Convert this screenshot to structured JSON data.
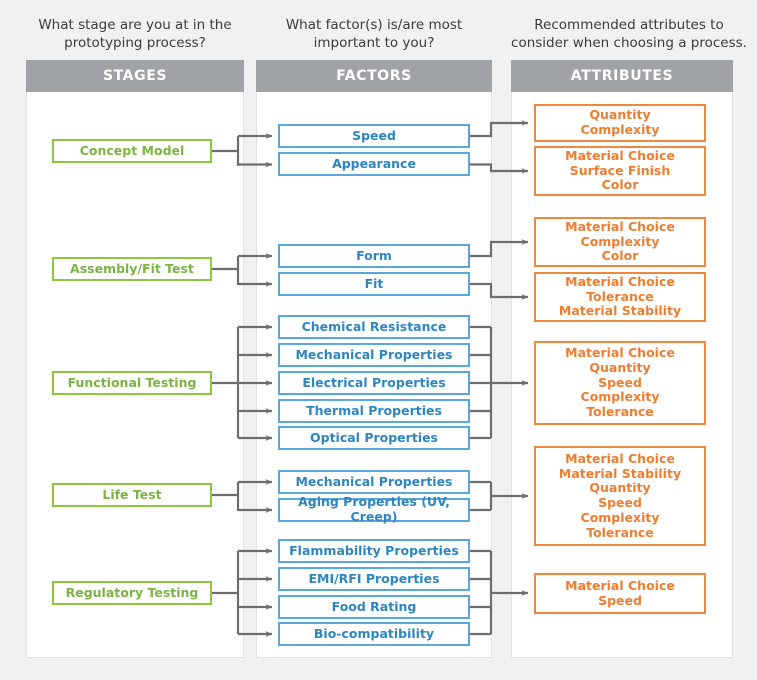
{
  "questions": {
    "stages": "What stage are you at in the prototyping process?",
    "factors": "What factor(s) is/are most important to you?",
    "attributes": "Recommended attributes to consider when choosing a process."
  },
  "headers": {
    "stages": "STAGES",
    "factors": "FACTORS",
    "attributes": "ATTRIBUTES"
  },
  "colors": {
    "background": "#f1f1f1",
    "panel": "#ffffff",
    "header": "#9fa3a6",
    "stage_border": "#8dc63f",
    "stage_text": "#7cb342",
    "factor_border": "#58a7dd",
    "factor_text": "#2e86c1",
    "attribute_border": "#f0883c",
    "attribute_text": "#ed7d31",
    "connector": "#6e6e6e"
  },
  "stages": [
    {
      "label": "Concept Model"
    },
    {
      "label": "Assembly/Fit Test"
    },
    {
      "label": "Functional Testing"
    },
    {
      "label": "Life Test"
    },
    {
      "label": "Regulatory Testing"
    }
  ],
  "factors": [
    {
      "label": "Speed"
    },
    {
      "label": "Appearance"
    },
    {
      "label": "Form"
    },
    {
      "label": "Fit"
    },
    {
      "label": "Chemical Resistance"
    },
    {
      "label": "Mechanical Properties"
    },
    {
      "label": "Electrical Properties"
    },
    {
      "label": "Thermal Properties"
    },
    {
      "label": "Optical Properties"
    },
    {
      "label": "Mechanical Properties"
    },
    {
      "label": "Aging Properties (UV, Creep)"
    },
    {
      "label": "Flammability Properties"
    },
    {
      "label": "EMI/RFI Properties"
    },
    {
      "label": "Food Rating"
    },
    {
      "label": "Bio-compatibility"
    }
  ],
  "attributes": [
    {
      "label": "Quantity\nComplexity"
    },
    {
      "label": "Material Choice\nSurface Finish\nColor"
    },
    {
      "label": "Material Choice\nComplexity\nColor"
    },
    {
      "label": "Material Choice\nTolerance\nMaterial Stability"
    },
    {
      "label": "Material Choice\nQuantity\nSpeed\nComplexity\nTolerance"
    },
    {
      "label": "Material Choice\nMaterial Stability\nQuantity\nSpeed\nComplexity\nTolerance"
    },
    {
      "label": "Material Choice\nSpeed"
    }
  ],
  "mapping": {
    "stage_to_factors": [
      {
        "stage": "Concept Model",
        "factors": [
          "Speed",
          "Appearance"
        ]
      },
      {
        "stage": "Assembly/Fit Test",
        "factors": [
          "Form",
          "Fit"
        ]
      },
      {
        "stage": "Functional Testing",
        "factors": [
          "Chemical Resistance",
          "Mechanical Properties",
          "Electrical Properties",
          "Thermal Properties",
          "Optical Properties"
        ]
      },
      {
        "stage": "Life Test",
        "factors": [
          "Mechanical Properties",
          "Aging Properties (UV, Creep)"
        ]
      },
      {
        "stage": "Regulatory Testing",
        "factors": [
          "Flammability Properties",
          "EMI/RFI Properties",
          "Food Rating",
          "Bio-compatibility"
        ]
      }
    ],
    "factors_to_attributes": [
      {
        "factors": [
          "Speed"
        ],
        "attribute": "Quantity\nComplexity"
      },
      {
        "factors": [
          "Appearance"
        ],
        "attribute": "Material Choice\nSurface Finish\nColor"
      },
      {
        "factors": [
          "Form"
        ],
        "attribute": "Material Choice\nComplexity\nColor"
      },
      {
        "factors": [
          "Fit"
        ],
        "attribute": "Material Choice\nTolerance\nMaterial Stability"
      },
      {
        "factors": [
          "Chemical Resistance",
          "Mechanical Properties",
          "Electrical Properties",
          "Thermal Properties",
          "Optical Properties"
        ],
        "attribute": "Material Choice\nQuantity\nSpeed\nComplexity\nTolerance"
      },
      {
        "factors": [
          "Mechanical Properties",
          "Aging Properties (UV, Creep)"
        ],
        "attribute": "Material Choice\nMaterial Stability\nQuantity\nSpeed\nComplexity\nTolerance"
      },
      {
        "factors": [
          "Flammability Properties",
          "EMI/RFI Properties",
          "Food Rating",
          "Bio-compatibility"
        ],
        "attribute": "Material Choice\nSpeed"
      }
    ]
  }
}
